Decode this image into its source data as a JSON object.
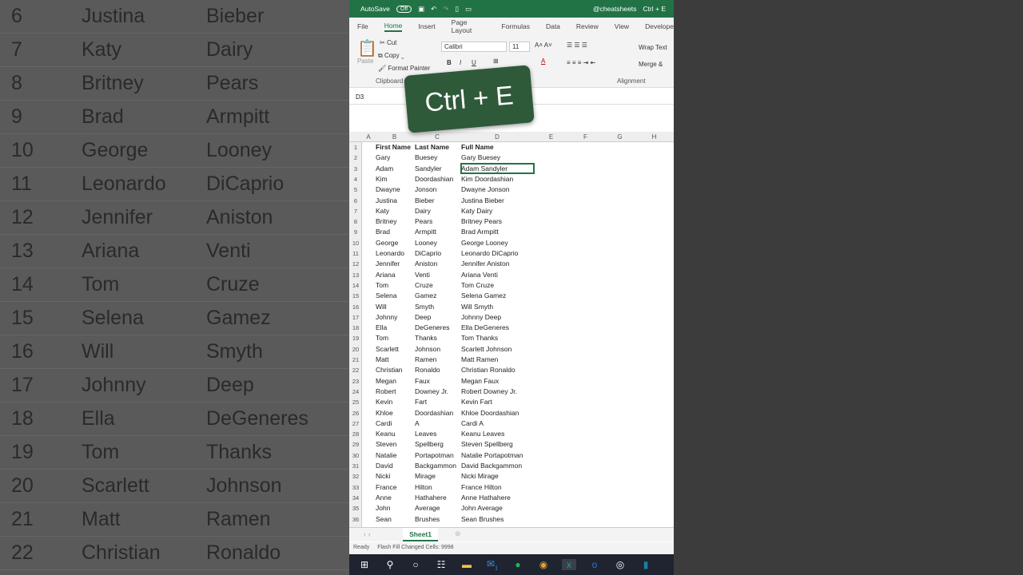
{
  "title_bar": {
    "autosave": "AutoSave",
    "toggle": "Off",
    "account": "@cheatsheets",
    "doc": "Ctrl + E"
  },
  "tabs": [
    "File",
    "Home",
    "Insert",
    "Page Layout",
    "Formulas",
    "Data",
    "Review",
    "View",
    "Develope"
  ],
  "ribbon": {
    "paste": "Paste",
    "cut": "Cut",
    "copy": "Copy",
    "format_painter": "Format Painter",
    "clipboard": "Clipboard",
    "font": "Calibri",
    "size": "11",
    "bold": "B",
    "italic": "I",
    "underline": "U",
    "wrap": "Wrap Text",
    "merge": "Merge &",
    "alignment": "Alignment"
  },
  "name_box": "D3",
  "overlay": "Ctrl + E",
  "columns": [
    "A",
    "B",
    "C",
    "D",
    "E",
    "F",
    "G",
    "H"
  ],
  "rows": [
    [
      "First Name",
      "Last Name",
      "Full Name"
    ],
    [
      "Gary",
      "Buesey",
      "Gary Buesey"
    ],
    [
      "Adam",
      "Sandyler",
      "Adam Sandyler"
    ],
    [
      "Kim",
      "Doordashian",
      "Kim Doordashian"
    ],
    [
      "Dwayne",
      "Jonson",
      "Dwayne Jonson"
    ],
    [
      "Justina",
      "Bieber",
      "Justina Bieber"
    ],
    [
      "Katy",
      "Dairy",
      "Katy Dairy"
    ],
    [
      "Britney",
      "Pears",
      "Britney Pears"
    ],
    [
      "Brad",
      "Armpitt",
      "Brad Armpitt"
    ],
    [
      "George",
      "Looney",
      "George Looney"
    ],
    [
      "Leonardo",
      "DiCaprio",
      "Leonardo DiCaprio"
    ],
    [
      "Jennifer",
      "Aniston",
      "Jennifer Aniston"
    ],
    [
      "Ariana",
      "Venti",
      "Ariana Venti"
    ],
    [
      "Tom",
      "Cruze",
      "Tom Cruze"
    ],
    [
      "Selena",
      "Gamez",
      "Selena Gamez"
    ],
    [
      "Will",
      "Smyth",
      "Will Smyth"
    ],
    [
      "Johnny",
      "Deep",
      "Johnny Deep"
    ],
    [
      "Ella",
      "DeGeneres",
      "Ella DeGeneres"
    ],
    [
      "Tom",
      "Thanks",
      "Tom Thanks"
    ],
    [
      "Scarlett",
      "Johnson",
      "Scarlett Johnson"
    ],
    [
      "Matt",
      "Ramen",
      "Matt Ramen"
    ],
    [
      "Christian",
      "Ronaldo",
      "Christian Ronaldo"
    ],
    [
      "Megan",
      "Faux",
      "Megan Faux"
    ],
    [
      "Robert",
      "Downey Jr.",
      "Robert Downey Jr."
    ],
    [
      "Kevin",
      "Fart",
      "Kevin Fart"
    ],
    [
      "Khloe",
      "Doordashian",
      "Khloe Doordashian"
    ],
    [
      "Cardi",
      "A",
      "Cardi A"
    ],
    [
      "Keanu",
      "Leaves",
      "Keanu Leaves"
    ],
    [
      "Steven",
      "Spellberg",
      "Steven Spellberg"
    ],
    [
      "Natalie",
      "Portapotman",
      "Natalie Portapotman"
    ],
    [
      "David",
      "Backgammon",
      "David Backgammon"
    ],
    [
      "Nicki",
      "Mirage",
      "Nicki Mirage"
    ],
    [
      "France",
      "Hilton",
      "France Hilton"
    ],
    [
      "Anne",
      "Hathahere",
      "Anne Hathahere"
    ],
    [
      "John",
      "Average",
      "John Average"
    ],
    [
      "Sean",
      "Brushes",
      "Sean Brushes"
    ]
  ],
  "sheet_tab": "Sheet1",
  "status": {
    "ready": "Ready",
    "message": "Flash Fill Changed Cells: 9998"
  },
  "taskbar_badge": "1",
  "colors": {
    "excel_green": "#217346"
  }
}
